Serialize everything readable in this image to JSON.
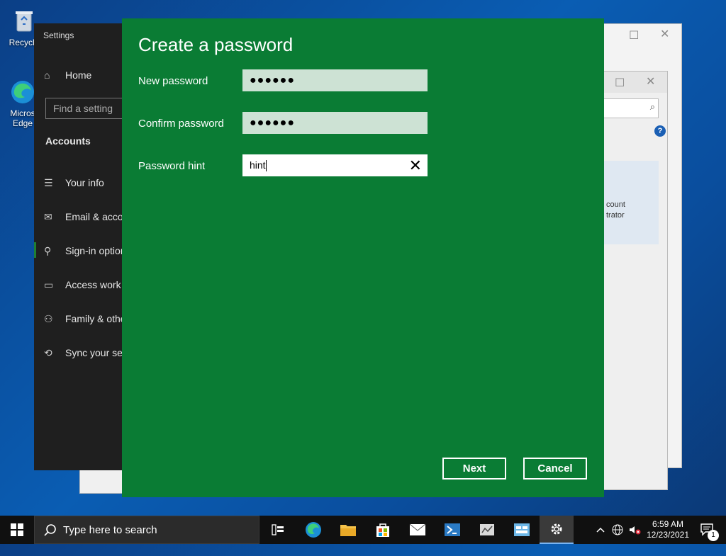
{
  "desktop": {
    "icons": [
      {
        "label": "Recycle"
      },
      {
        "label": "Micros\nEdge"
      }
    ]
  },
  "settings": {
    "title": "Settings",
    "home_label": "Home",
    "search_placeholder": "Find a setting",
    "section": "Accounts",
    "nav": [
      {
        "label": "Your info",
        "icon": "person-card-icon"
      },
      {
        "label": "Email & accounts",
        "icon": "mail-icon"
      },
      {
        "label": "Sign-in options",
        "icon": "key-icon"
      },
      {
        "label": "Access work or school",
        "icon": "briefcase-icon"
      },
      {
        "label": "Family & other users",
        "icon": "person-add-icon"
      },
      {
        "label": "Sync your settings",
        "icon": "sync-icon"
      }
    ]
  },
  "background_window": {
    "partial_text_1": "count",
    "partial_text_2": "trator"
  },
  "dialog": {
    "title": "Create a password",
    "fields": [
      {
        "label": "New password",
        "value": "●●●●●●"
      },
      {
        "label": "Confirm password",
        "value": "●●●●●●"
      },
      {
        "label": "Password hint",
        "value": "hint"
      }
    ],
    "next_label": "Next",
    "cancel_label": "Cancel",
    "clear_glyph": "✕"
  },
  "taskbar": {
    "search_placeholder": "Type here to search",
    "time": "6:59 AM",
    "date": "12/23/2021",
    "notification_count": "1"
  },
  "colors": {
    "dialog_bg": "#0a7c34",
    "settings_bg": "#1f1f1f",
    "taskbar_bg": "#101010"
  }
}
